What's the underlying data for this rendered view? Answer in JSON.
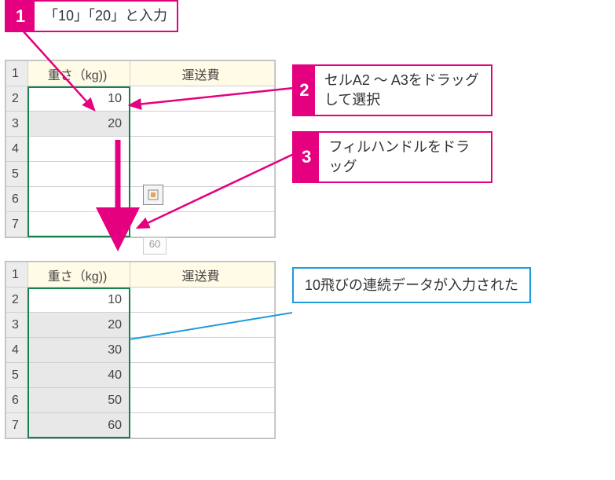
{
  "steps": {
    "s1": {
      "num": "1",
      "text": "「10」「20」と入力"
    },
    "s2": {
      "num": "2",
      "text": "セルA2 ～ A3をドラッグして選択"
    },
    "s3": {
      "num": "3",
      "text": "フィルハンドルをドラッグ"
    }
  },
  "result": "10飛びの連続データが入力された",
  "sheet1": {
    "headers": {
      "colA": "重さ（kg))",
      "colB": "運送費"
    },
    "rows": [
      "1",
      "2",
      "3",
      "4",
      "5",
      "6",
      "7"
    ],
    "values": {
      "r2": "10",
      "r3": "20"
    },
    "hint60": "60"
  },
  "sheet2": {
    "headers": {
      "colA": "重さ（kg))",
      "colB": "運送費"
    },
    "rows": [
      "1",
      "2",
      "3",
      "4",
      "5",
      "6",
      "7"
    ],
    "values": {
      "r2": "10",
      "r3": "20",
      "r4": "30",
      "r5": "40",
      "r6": "50",
      "r7": "60"
    }
  }
}
